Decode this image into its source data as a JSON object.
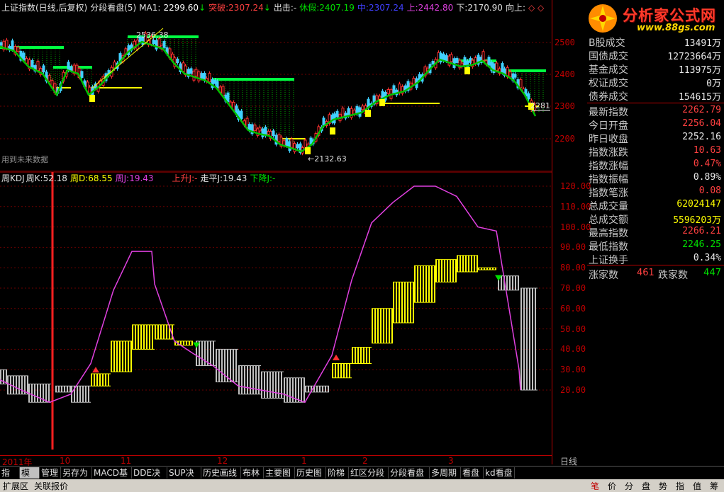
{
  "top_header": {
    "title": "上证指数(日线,后复权)",
    "indicator": "分段看盘(5)",
    "ma_label": "MA1:",
    "ma_value": "2299.60",
    "ma_arrow": "↓",
    "break_label": "突破:",
    "break_value": "2307.24",
    "break_arrow": "↓",
    "exit_label": "出击:",
    "exit_value": "-",
    "rest_label": "休假:",
    "rest_value": "2407.19",
    "mid_label": "中:",
    "mid_value": "2307.24",
    "up_label": "上:",
    "up_value": "2442.80",
    "down_label": "下:",
    "down_value": "2170.90",
    "dir_label": "向上:"
  },
  "main_chart": {
    "y_ticks": [
      "2500",
      "2400",
      "2300",
      "2200"
    ],
    "annotations": {
      "high_label": "2536.38",
      "low_label": "←2132.63",
      "last_label": "2281",
      "future_note": "用到未来数据"
    }
  },
  "kdj_header": {
    "name": "周KDJ",
    "k_label": "周K:",
    "k_value": "52.18",
    "d_label": "周D:",
    "d_value": "68.55",
    "j_label": "周J:",
    "j_value": "19.43",
    "rise_label": "上升J:",
    "rise_value": "-",
    "flat_label": "走平J:",
    "flat_value": "19.43",
    "fall_label": "下降J:",
    "fall_value": "-"
  },
  "kdj_chart": {
    "y_ticks": [
      "120.00",
      "110.00",
      "100.00",
      "90.00",
      "80.00",
      "70.00",
      "60.00",
      "50.00",
      "40.00",
      "30.00",
      "20.00"
    ]
  },
  "date_axis": {
    "labels": [
      "2011年",
      "10",
      "11",
      "12",
      "1",
      "2",
      "3"
    ],
    "period_button": "日线"
  },
  "quote_panel": {
    "partial_top": "13491万",
    "rows": [
      {
        "k": "B股成交",
        "v": "13491万",
        "c": "white"
      },
      {
        "k": "国债成交",
        "v": "12723664万",
        "c": "white"
      },
      {
        "k": "基金成交",
        "v": "113975万",
        "c": "white"
      },
      {
        "k": "权证成交",
        "v": "0万",
        "c": "white"
      },
      {
        "k": "债券成交",
        "v": "154615万",
        "c": "white"
      }
    ],
    "rows2": [
      {
        "k": "最新指数",
        "v": "2262.79",
        "c": "red"
      },
      {
        "k": "今日开盘",
        "v": "2256.04",
        "c": "red"
      },
      {
        "k": "昨日收盘",
        "v": "2252.16",
        "c": "white"
      },
      {
        "k": "指数涨跌",
        "v": "10.63",
        "c": "red"
      },
      {
        "k": "指数涨幅",
        "v": "0.47%",
        "c": "red"
      },
      {
        "k": "指数振幅",
        "v": "0.89%",
        "c": "white"
      },
      {
        "k": "指数笔涨",
        "v": "0.08",
        "c": "red"
      },
      {
        "k": "总成交量",
        "v": "62024147",
        "c": "yel"
      },
      {
        "k": "总成交额",
        "v": "5596203万",
        "c": "yel"
      },
      {
        "k": "最高指数",
        "v": "2266.21",
        "c": "red"
      },
      {
        "k": "最低指数",
        "v": "2246.25",
        "c": "green"
      },
      {
        "k": "上证换手",
        "v": "0.34%",
        "c": "white"
      }
    ],
    "rise_count_label": "涨家数",
    "rise_count": "461",
    "fall_count_label": "跌家数",
    "fall_count": "447"
  },
  "logo": {
    "text": "分析家公式网",
    "url_text": "www.88gs.com"
  },
  "tabs": [
    {
      "label": "指标",
      "selected": false
    },
    {
      "label": "模板",
      "selected": true
    },
    {
      "label": "管理",
      "selected": false
    },
    {
      "label": "另存为",
      "selected": false
    },
    {
      "label": "MACD基本",
      "selected": false
    },
    {
      "label": "DDE决策",
      "selected": false
    },
    {
      "label": "SUP决策",
      "selected": false
    },
    {
      "label": "历史画线",
      "selected": false
    },
    {
      "label": "布林",
      "selected": false
    },
    {
      "label": "主要图",
      "selected": false
    },
    {
      "label": "历史图",
      "selected": false
    },
    {
      "label": "阶梯",
      "selected": false
    },
    {
      "label": "红区分段",
      "selected": false
    },
    {
      "label": "分段看盘",
      "selected": false
    },
    {
      "label": "多周期",
      "selected": false
    },
    {
      "label": "看盘",
      "selected": false
    },
    {
      "label": "kd看盘",
      "selected": false
    }
  ],
  "bottom_bar": {
    "left_items": [
      "扩展区",
      "关联报价"
    ],
    "right_icons": [
      "笔",
      "价",
      "分",
      "盘",
      "势",
      "指",
      "值",
      "筹"
    ]
  },
  "colors": {
    "up": "#ff3030",
    "down": "#40d0ff",
    "ma_green": "#00c000",
    "yellow": "#ffff00",
    "grid_red": "#b00000",
    "magenta": "#e040e0"
  }
}
